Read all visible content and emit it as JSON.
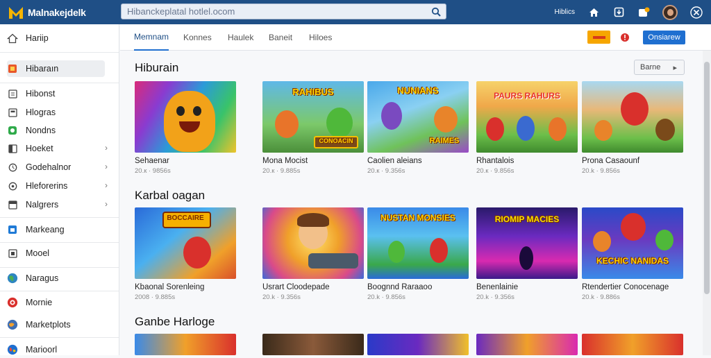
{
  "app": {
    "name": "Malnakejdelk"
  },
  "search": {
    "placeholder": "Hibanckeplatal hotlel.ocom"
  },
  "topbar": {
    "link": "Hiblics"
  },
  "sidebar": {
    "items": [
      {
        "label": "Hariip",
        "icon": "home-icon"
      },
      {
        "label": "Hibaraın",
        "icon": "grid-icon"
      },
      {
        "label": "Hibonst",
        "icon": "bookmark-icon"
      },
      {
        "label": "Hlogras",
        "icon": "document-icon"
      },
      {
        "label": "Nondns",
        "icon": "game-icon"
      },
      {
        "label": "Hoeket",
        "icon": "folder-icon"
      },
      {
        "label": "Godehalnor",
        "icon": "clock-icon"
      },
      {
        "label": "Hleforerins",
        "icon": "tag-icon"
      },
      {
        "label": "Nalgrers",
        "icon": "card-icon"
      },
      {
        "label": "Markeang",
        "icon": "store-icon"
      },
      {
        "label": "Mooel",
        "icon": "box-icon"
      },
      {
        "label": "Naragus",
        "icon": "globe-icon"
      },
      {
        "label": "Mornie",
        "icon": "target-icon"
      },
      {
        "label": "Marketplots",
        "icon": "planet-icon"
      },
      {
        "label": "Marioorl",
        "icon": "world-icon"
      }
    ]
  },
  "tabs": [
    {
      "label": "Memnam"
    },
    {
      "label": "Konnes"
    },
    {
      "label": "Haulek"
    },
    {
      "label": "Baneit"
    },
    {
      "label": "Hiloes"
    }
  ],
  "header_actions": {
    "primary": "Onsiarew"
  },
  "sections": [
    {
      "title": "Hiburain",
      "more": "Barne",
      "cards": [
        {
          "title": "Sehaenar",
          "meta": "20.к   · 9856s"
        },
        {
          "title": "Mona Mocist",
          "meta": "20.к   · 9.885s"
        },
        {
          "title": "Caolien aleians",
          "meta": "20.к   · 9.356s"
        },
        {
          "title": "Rhantalois",
          "meta": "20.к   · 9.856s"
        },
        {
          "title": "Prona Casaounf",
          "meta": "20.k   · 9.856s"
        }
      ]
    },
    {
      "title": "Karbal oagan",
      "cards": [
        {
          "title": "Kbaonal Sorenleing",
          "meta": "2008 · 9.885s"
        },
        {
          "title": "Usrart Cloodepade",
          "meta": "20.k   · 9.356s"
        },
        {
          "title": "Boognnd Raraaoo",
          "meta": "20.k   · 9.856s"
        },
        {
          "title": "Benenlainie",
          "meta": "20.k   · 9.356s"
        },
        {
          "title": "Rtendertier Conocenage",
          "meta": "20.k   · 9.886s"
        }
      ]
    },
    {
      "title": "Ganbe Harloge"
    }
  ],
  "thumb_labels": [
    "",
    "RAHIBUS",
    "NUNIANS",
    "PAURS RAHURS",
    "",
    "CONOACIN",
    "RAIMES",
    "",
    "BOCCAIRE",
    "",
    "NUSTAN MONSIES",
    "RIOMIP MACIES",
    "KECHIC NANIDAS"
  ],
  "colors": {
    "topbar": "#1f4f86",
    "accent": "#1f6fd0",
    "orange": "#f6a600"
  }
}
